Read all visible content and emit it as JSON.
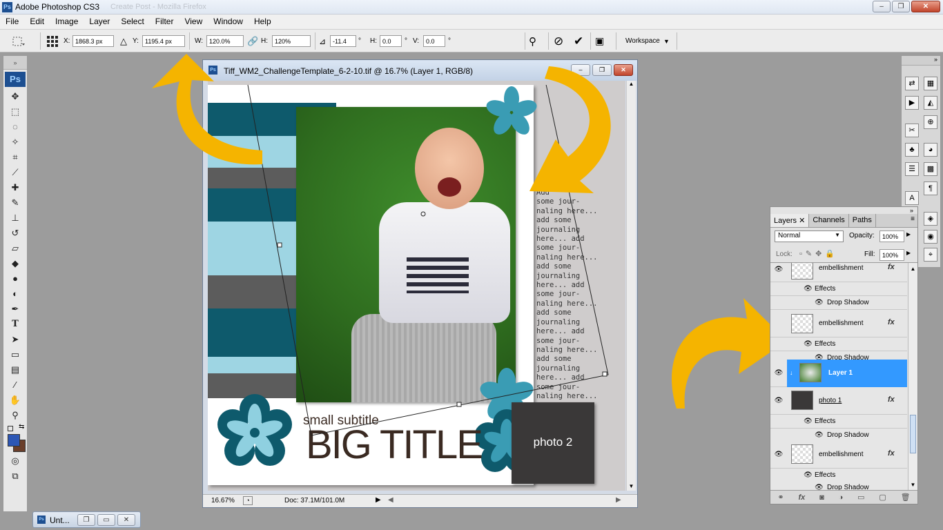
{
  "app": {
    "title": "Adobe Photoshop CS3",
    "logo": "Ps",
    "ghost_title": "Create Post - Mozilla Firefox"
  },
  "window_buttons": {
    "minimize": "‒",
    "restore": "❐",
    "close": "✕"
  },
  "menu": [
    "File",
    "Edit",
    "Image",
    "Layer",
    "Select",
    "Filter",
    "View",
    "Window",
    "Help"
  ],
  "options": {
    "x_label": "X:",
    "x_value": "1868.3 px",
    "y_label": "Y:",
    "y_value": "1195.4 px",
    "w_label": "W:",
    "w_value": "120.0%",
    "h_label": "H:",
    "h_value": "120%",
    "angle_value": "-11.4",
    "degree": "°",
    "hskew_label": "H:",
    "hskew_value": "0.0",
    "vskew_label": "V:",
    "vskew_value": "0.0",
    "workspace_label": "Workspace"
  },
  "document": {
    "title": "Tiff_WM2_ChallengeTemplate_6-2-10.tif @ 16.7% (Layer 1, RGB/8)",
    "zoom": "16.67%",
    "doc_info": "Doc: 37.1M/101.0M",
    "subtitle_text": "small subtitle",
    "big_title": "BIG TITLE",
    "photo2_label": "photo 2",
    "journal_lines": [
      "Add",
      "some jour-",
      "naling here...",
      "add some",
      "journaling",
      "here... add",
      "some jour-",
      "naling here...",
      "add some",
      "journaling",
      "here... add",
      "some jour-",
      "naling here...",
      "add some",
      "journaling",
      "here... add",
      "some jour-",
      "naling here...",
      "add some",
      "journaling",
      "here... add",
      "some jour-",
      "naling here..."
    ]
  },
  "colors": {
    "teal_dark": "#0e5a6c",
    "teal_light": "#9ed5e3",
    "gray_stripe": "#5c5c5c",
    "arrow_yellow": "#f5b400",
    "selected_layer": "#3399ff",
    "flower_dark": "#0e5a6c",
    "flower_mid": "#3a9cb4",
    "flower_light": "#8fd0e0"
  },
  "layers_panel": {
    "tabs": [
      "Layers",
      "Channels",
      "Paths"
    ],
    "blend_mode": "Normal",
    "opacity_label": "Opacity:",
    "opacity_value": "100%",
    "lock_label": "Lock:",
    "fill_label": "Fill:",
    "fill_value": "100%",
    "rows": [
      {
        "name": "embellishment",
        "fx": "fx",
        "effects": "Effects",
        "effect": "Drop Shadow"
      },
      {
        "name": "embellishment",
        "fx": "fx",
        "effects": "Effects",
        "effect": "Drop Shadow"
      },
      {
        "name": "Layer 1"
      },
      {
        "name": "photo 1",
        "fx": "fx",
        "effects": "Effects",
        "effect": "Drop Shadow"
      },
      {
        "name": "embellishment",
        "fx": "fx",
        "effects": "Effects",
        "effect": "Drop Shadow"
      }
    ]
  },
  "taskbar": {
    "label": "Unt..."
  }
}
